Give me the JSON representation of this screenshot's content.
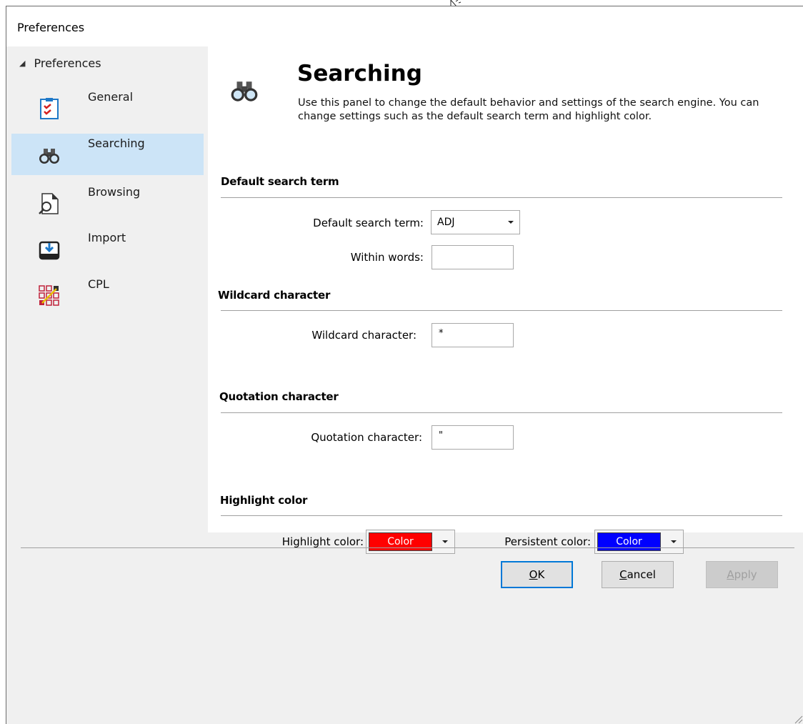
{
  "window": {
    "title": "Preferences"
  },
  "sidebar": {
    "root_label": "Preferences",
    "items": [
      {
        "label": "General",
        "icon": "checklist-icon"
      },
      {
        "label": "Searching",
        "icon": "binoculars-icon",
        "selected": true
      },
      {
        "label": "Browsing",
        "icon": "document-magnifier-icon"
      },
      {
        "label": "Import",
        "icon": "import-tray-icon"
      },
      {
        "label": "CPL",
        "icon": "grid-pencil-icon"
      }
    ]
  },
  "header": {
    "title": "Searching",
    "description": "Use this panel to change the default behavior and settings of the search engine. You can change settings such as the default search term and highlight color."
  },
  "sections": {
    "default_search": {
      "title": "Default search term",
      "term_label": "Default search term:",
      "term_value": "ADJ",
      "within_label": "Within words:",
      "within_value": ""
    },
    "wildcard": {
      "title": "Wildcard character",
      "label": "Wildcard character:",
      "value": "*"
    },
    "quotation": {
      "title": "Quotation character",
      "label": "Quotation character:",
      "value": "\""
    },
    "highlight": {
      "title": "Highlight color",
      "highlight_label": "Highlight color:",
      "highlight_swatch_text": "Color",
      "highlight_color": "#ff0000",
      "persistent_label": "Persistent color:",
      "persistent_swatch_text": "Color",
      "persistent_color": "#0000ff"
    }
  },
  "footer": {
    "ok_prefix": "",
    "ok_mnemonic": "O",
    "ok_rest": "K",
    "cancel_mnemonic": "C",
    "cancel_rest": "ancel",
    "apply_mnemonic": "A",
    "apply_rest": "pply"
  },
  "colors": {
    "selected_bg": "#cce4f7",
    "default_button_border": "#0078d7"
  }
}
